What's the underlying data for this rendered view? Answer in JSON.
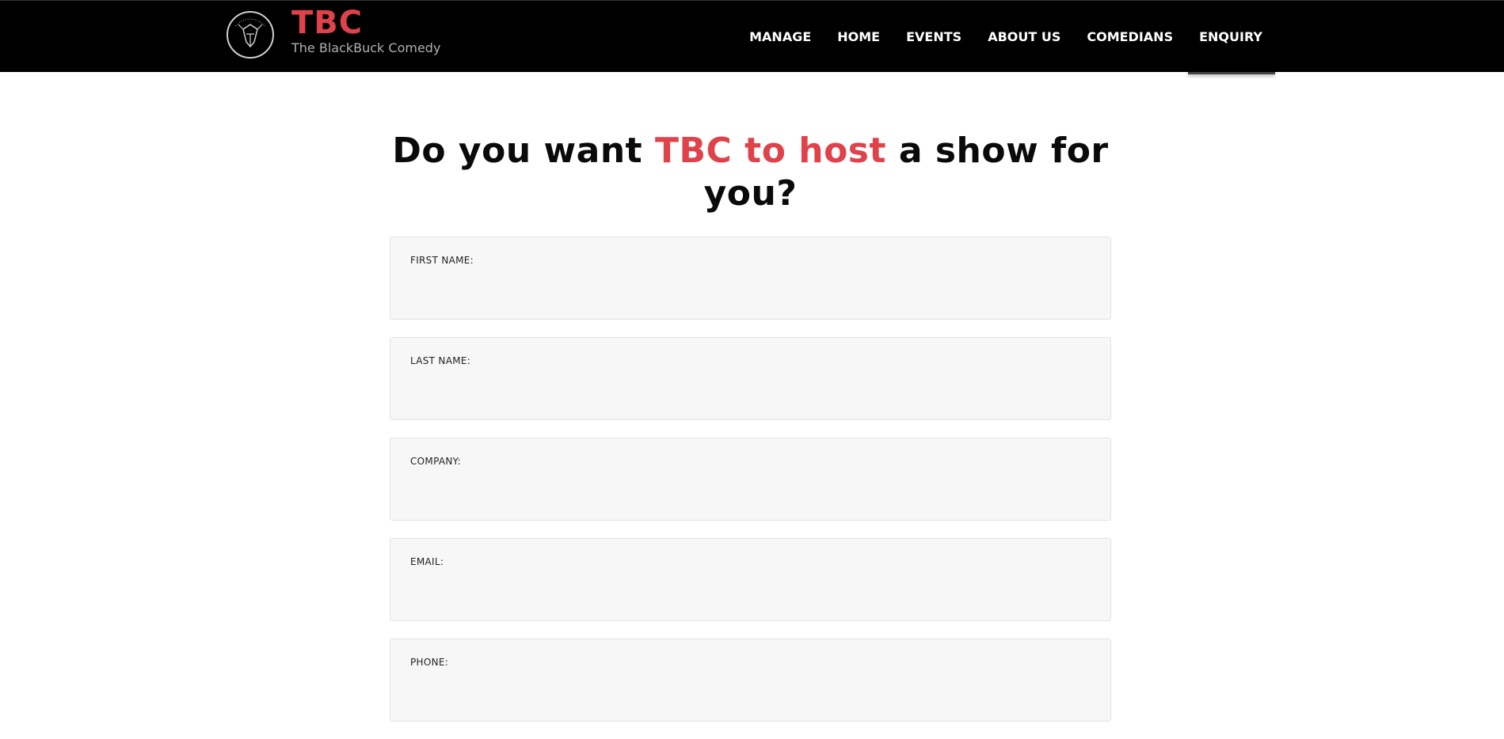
{
  "brand": {
    "title": "TBC",
    "subtitle": "The BlackBuck Comedy",
    "accent_color": "#e0424b"
  },
  "nav": {
    "items": [
      {
        "label": "MANAGE"
      },
      {
        "label": "HOME"
      },
      {
        "label": "EVENTS"
      },
      {
        "label": "ABOUT US"
      },
      {
        "label": "COMEDIANS"
      },
      {
        "label": "ENQUIRY"
      }
    ]
  },
  "heading": {
    "part1": "Do you want ",
    "accent": "TBC to host",
    "part2": " a show for you?"
  },
  "form": {
    "fields": [
      {
        "label": "FIRST NAME:",
        "value": ""
      },
      {
        "label": "LAST NAME:",
        "value": ""
      },
      {
        "label": "COMPANY:",
        "value": ""
      },
      {
        "label": "EMAIL:",
        "value": ""
      },
      {
        "label": "PHONE:",
        "value": ""
      }
    ]
  }
}
